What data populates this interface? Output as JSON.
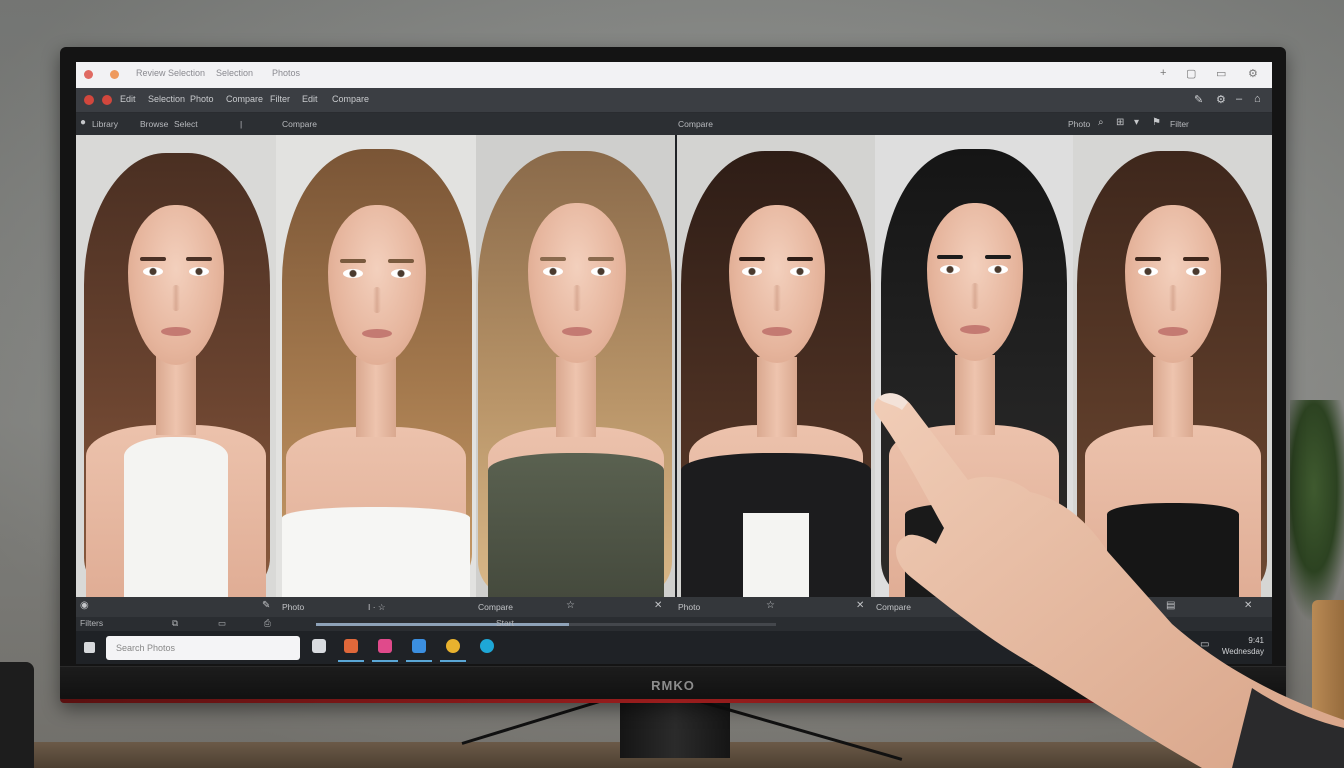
{
  "monitor": {
    "brand": "RMKO"
  },
  "browser": {
    "tab_text": "Review Selection",
    "tab_text_2": "Selection",
    "tab_text_3": "Photos"
  },
  "toolbar": {
    "items": [
      "Edit",
      "Selection",
      "Photo",
      "Compare",
      "Filter",
      "Edit",
      "Compare"
    ]
  },
  "left_pane": {
    "title": "Library",
    "breadcrumb": [
      "Browse",
      "Select",
      "|",
      "Compare"
    ],
    "captions": [
      "Photo",
      "Compare",
      "Photo"
    ]
  },
  "right_pane": {
    "title": "Compare",
    "tools": [
      "Photo",
      "Filter"
    ],
    "captions": [
      "Photo",
      "Compare"
    ]
  },
  "status": {
    "left": "Filters",
    "mid": "Start"
  },
  "progress": {
    "percent": 55
  },
  "taskbar": {
    "search_placeholder": "Search Photos",
    "clock_time": "9:41",
    "clock_date": "Wednesday"
  },
  "colors": {
    "accent": "#5aa7d6",
    "close_red": "#d2473d",
    "brand_red": "#9a1d1d"
  },
  "icons": [
    "search-icon",
    "gear-icon",
    "close-icon",
    "minimize-icon",
    "filter-icon"
  ]
}
